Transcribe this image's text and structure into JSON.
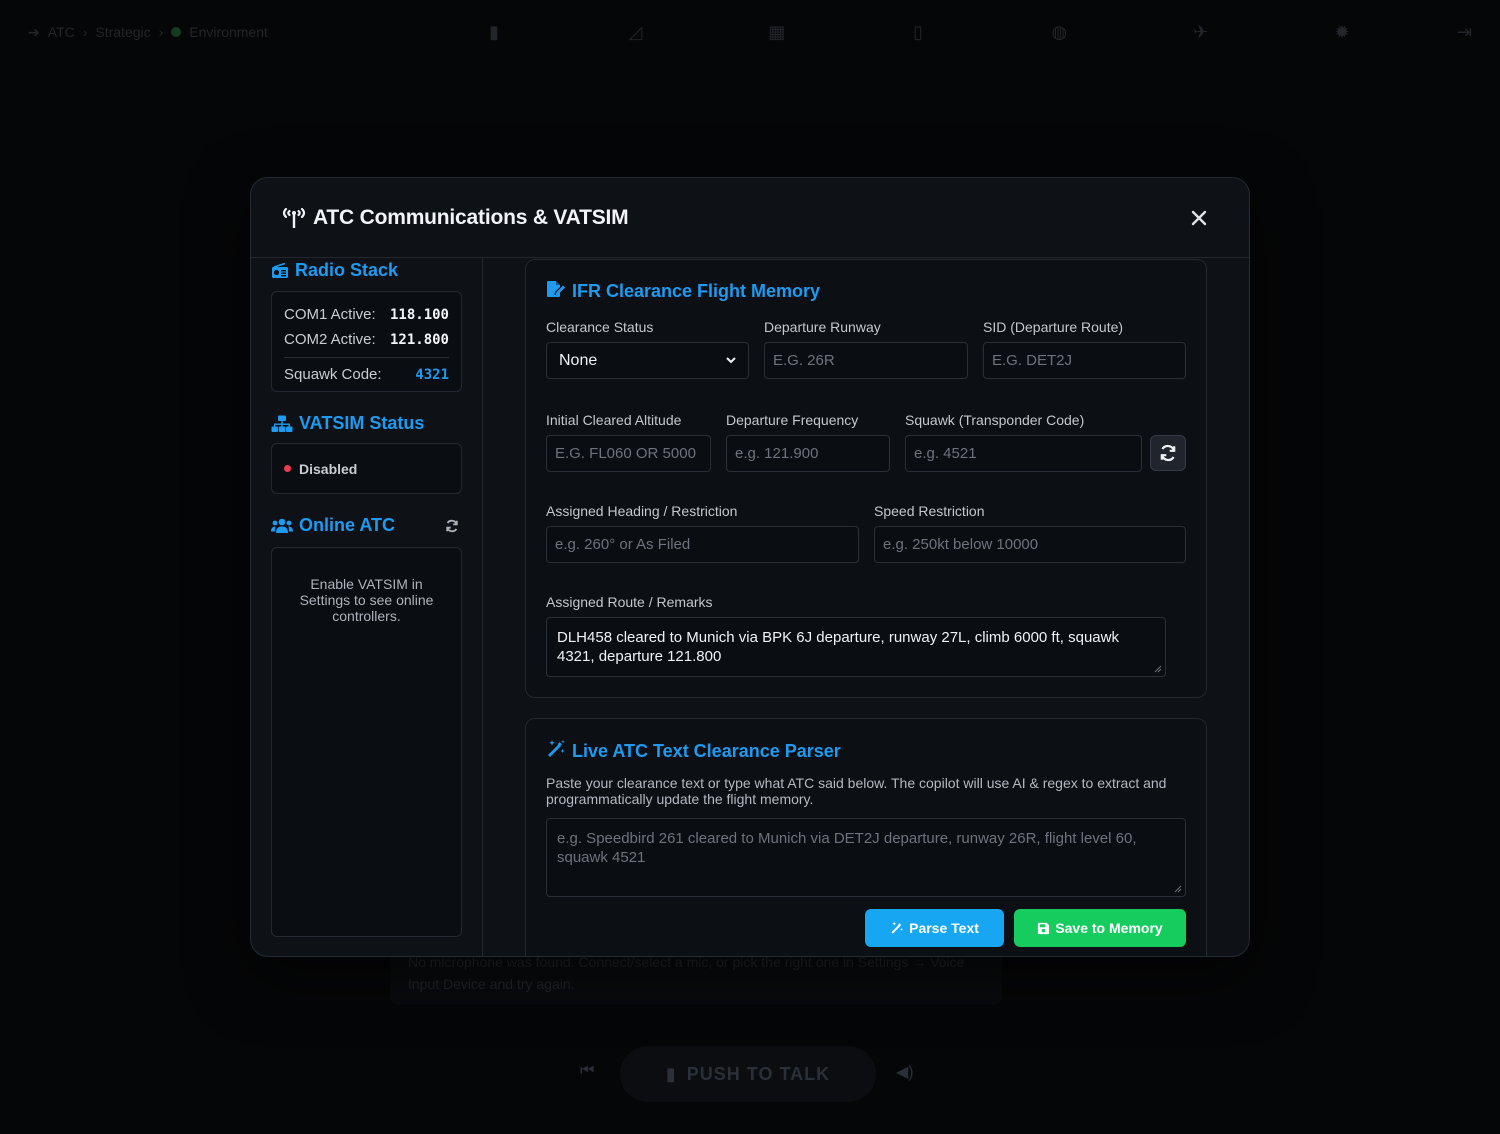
{
  "background": {
    "crumbs": [
      "ATC",
      "Strategic",
      "Environment"
    ],
    "push_to_talk": "PUSH TO TALK",
    "notice": "No microphone was found. Connect/select a mic, or pick the right one in Settings → Voice Input Device and try again."
  },
  "modal": {
    "title": "ATC Communications & VATSIM",
    "close_icon": "close-icon"
  },
  "radio_stack": {
    "title": "Radio Stack",
    "com1_label": "COM1 Active:",
    "com1_value": "118.100",
    "com2_label": "COM2 Active:",
    "com2_value": "121.800",
    "squawk_label": "Squawk Code:",
    "squawk_value": "4321"
  },
  "vatsim_status": {
    "title": "VATSIM Status",
    "status": "Disabled",
    "status_color": "#ef3b4e"
  },
  "online_atc": {
    "title": "Online ATC",
    "message": "Enable VATSIM in Settings to see online controllers."
  },
  "ifr": {
    "title": "IFR Clearance Flight Memory",
    "clearance_status_label": "Clearance Status",
    "clearance_status_value": "None",
    "departure_runway_label": "Departure Runway",
    "departure_runway_placeholder": "E.G. 26R",
    "sid_label": "SID (Departure Route)",
    "sid_placeholder": "E.G. DET2J",
    "initial_alt_label": "Initial Cleared Altitude",
    "initial_alt_placeholder": "E.G. FL060 OR 5000",
    "dep_freq_label": "Departure Frequency",
    "dep_freq_placeholder": "e.g. 121.900",
    "squawk_label": "Squawk (Transponder Code)",
    "squawk_placeholder": "e.g. 4521",
    "heading_label": "Assigned Heading / Restriction",
    "heading_placeholder": "e.g. 260° or As Filed",
    "speed_label": "Speed Restriction",
    "speed_placeholder": "e.g. 250kt below 10000",
    "route_label": "Assigned Route / Remarks",
    "route_value": "DLH458 cleared to Munich via BPK 6J departure, runway 27L, climb 6000 ft, squawk 4321, departure 121.800"
  },
  "parser": {
    "title": "Live ATC Text Clearance Parser",
    "description": "Paste your clearance text or type what ATC said below. The copilot will use AI & regex to extract and programmatically update the flight memory.",
    "placeholder": "e.g. Speedbird 261 cleared to Munich via DET2J departure, runway 26R, flight level 60, squawk 4521",
    "parse_button": "Parse Text",
    "save_button": "Save to Memory"
  },
  "colors": {
    "accent_blue": "#1e9bf0",
    "parse_blue": "#17a7f2",
    "save_green": "#17cc5f"
  }
}
